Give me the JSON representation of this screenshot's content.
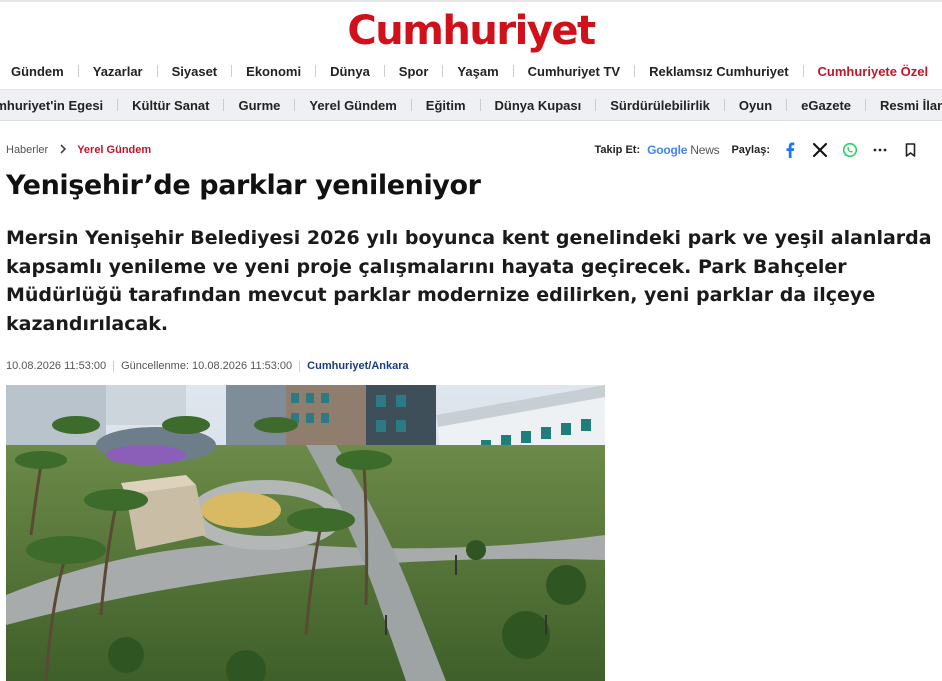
{
  "site": {
    "logo_text": "Cumhuriyet",
    "brand_color": "#d0111b"
  },
  "nav_primary": [
    {
      "label": "Gündem"
    },
    {
      "label": "Yazarlar"
    },
    {
      "label": "Siyaset"
    },
    {
      "label": "Ekonomi"
    },
    {
      "label": "Dünya"
    },
    {
      "label": "Spor"
    },
    {
      "label": "Yaşam"
    },
    {
      "label": "Cumhuriyet TV"
    },
    {
      "label": "Reklamsız Cumhuriyet"
    },
    {
      "label": "Cumhuriyete Özel"
    }
  ],
  "nav_secondary": [
    {
      "label": "Cumhuriyet'in Egesi"
    },
    {
      "label": "Kültür Sanat"
    },
    {
      "label": "Gurme"
    },
    {
      "label": "Yerel Gündem"
    },
    {
      "label": "Eğitim"
    },
    {
      "label": "Dünya Kupası"
    },
    {
      "label": "Sürdürülebilirlik"
    },
    {
      "label": "Oyun"
    },
    {
      "label": "eGazete"
    },
    {
      "label": "Resmi İlanlar"
    }
  ],
  "breadcrumb": {
    "home": "Haberler",
    "current": "Yerel Gündem"
  },
  "share": {
    "follow_label": "Takip Et:",
    "google_news": {
      "google": "Google",
      "news": "News"
    },
    "share_label": "Paylaş:",
    "icons": [
      "facebook-icon",
      "x-icon",
      "whatsapp-icon",
      "more-icon",
      "bookmark-icon"
    ]
  },
  "article": {
    "title": "Yenişehir’de parklar yenileniyor",
    "summary": "Mersin Yenişehir Belediyesi 2026 yılı boyunca kent genelindeki park ve yeşil alanlarda kapsamlı yenileme ve yeni proje çalışmalarını hayata geçirecek. Park Bahçeler Müdürlüğü tarafından mevcut parklar modernize edilirken, yeni parklar da ilçeye kazandırılacak.",
    "published": "10.08.2026 11:53:00",
    "updated": "Güncellenme: 10.08.2026 11:53:00",
    "source": "Cumhuriyet/Ankara"
  }
}
